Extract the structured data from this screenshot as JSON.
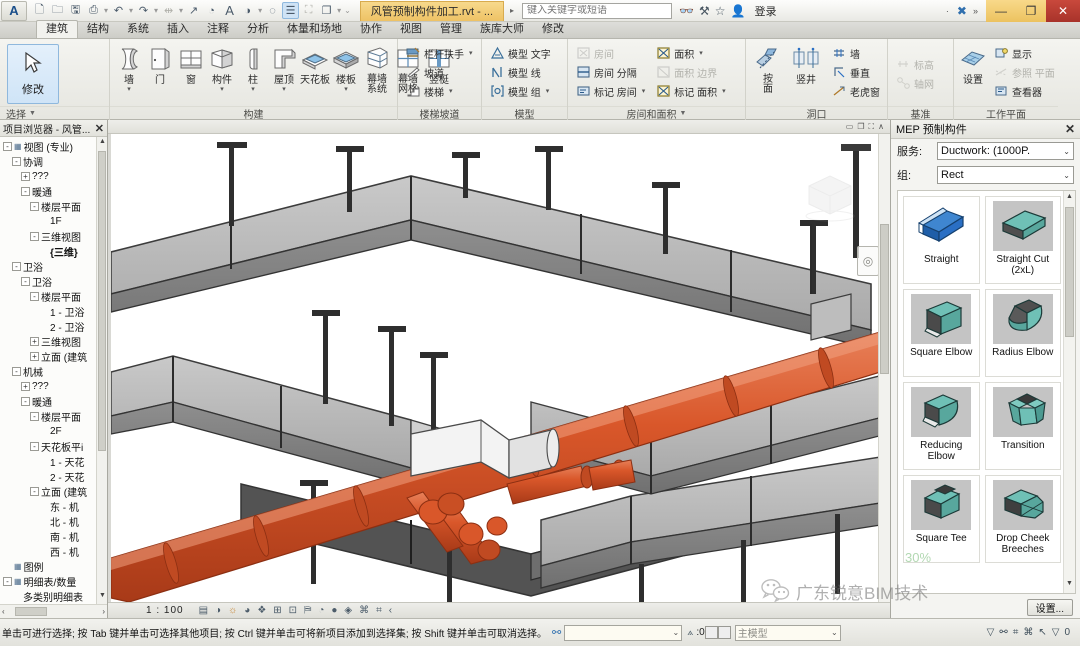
{
  "titlebar": {
    "app_button": "A",
    "doc_title": "风管预制构件加工.rvt - ...",
    "search_placeholder": "键入关键字或短语",
    "signin_label": "登录",
    "quick_access": [
      {
        "name": "new-file-icon",
        "glyph": "⬜"
      },
      {
        "name": "open-file-icon",
        "glyph": "🗁"
      },
      {
        "name": "save-icon",
        "glyph": "💾"
      },
      {
        "name": "print-icon",
        "glyph": "⎙"
      },
      {
        "name": "undo-icon",
        "glyph": "↶"
      },
      {
        "name": "redo-icon",
        "glyph": "↷"
      },
      {
        "name": "measure-icon",
        "glyph": "⇔"
      },
      {
        "name": "aligned-dimension-icon",
        "glyph": "↗"
      },
      {
        "name": "tag-icon",
        "glyph": "◔"
      },
      {
        "name": "text-icon",
        "glyph": "A"
      },
      {
        "name": "default-3d-view-icon",
        "glyph": "◑"
      },
      {
        "name": "section-icon",
        "glyph": "○"
      },
      {
        "name": "thin-lines-icon",
        "glyph": "☷"
      },
      {
        "name": "close-hidden-windows-icon",
        "glyph": "⛶"
      },
      {
        "name": "switch-windows-icon",
        "glyph": "❐"
      }
    ],
    "toolbar_icons": [
      {
        "name": "help-search-icon",
        "glyph": "♀"
      },
      {
        "name": "exchange-icon",
        "glyph": "⚒"
      },
      {
        "name": "favorites-star-icon",
        "glyph": "☆"
      },
      {
        "name": "user-account-icon",
        "glyph": "👤"
      }
    ],
    "window_controls": [
      {
        "name": "minimize-button",
        "glyph": "—"
      },
      {
        "name": "maximize-button",
        "glyph": "❐"
      },
      {
        "name": "close-button",
        "glyph": "✕"
      }
    ]
  },
  "ribbon_tabs": [
    {
      "label": "建筑",
      "active": true
    },
    {
      "label": "结构",
      "active": false
    },
    {
      "label": "系统",
      "active": false
    },
    {
      "label": "插入",
      "active": false
    },
    {
      "label": "注释",
      "active": false
    },
    {
      "label": "分析",
      "active": false
    },
    {
      "label": "体量和场地",
      "active": false
    },
    {
      "label": "协作",
      "active": false
    },
    {
      "label": "视图",
      "active": false
    },
    {
      "label": "管理",
      "active": false
    },
    {
      "label": "族库大师",
      "active": false
    },
    {
      "label": "修改",
      "active": false
    }
  ],
  "ribbon": {
    "select_panel": {
      "title": "选择",
      "modify_label": "修改"
    },
    "build_panel": {
      "title": "构建",
      "items": [
        {
          "label": "墙",
          "dropdown": true,
          "icon": "wall-icon"
        },
        {
          "label": "门",
          "dropdown": false,
          "icon": "door-icon"
        },
        {
          "label": "窗",
          "dropdown": false,
          "icon": "window-icon"
        },
        {
          "label": "构件",
          "dropdown": true,
          "icon": "component-icon"
        },
        {
          "label": "柱",
          "dropdown": true,
          "icon": "column-icon"
        },
        {
          "label": "屋顶",
          "dropdown": true,
          "icon": "roof-icon"
        },
        {
          "label": "天花板",
          "dropdown": false,
          "icon": "ceiling-icon"
        },
        {
          "label": "楼板",
          "dropdown": true,
          "icon": "floor-icon"
        },
        {
          "label": "幕墙\n系统",
          "dropdown": false,
          "icon": "curtain-system-icon"
        },
        {
          "label": "幕墙\n网格",
          "dropdown": false,
          "icon": "curtain-grid-icon"
        },
        {
          "label": "竖梃",
          "dropdown": false,
          "icon": "mullion-icon"
        }
      ]
    },
    "stairs_panel": {
      "title": "楼梯坡道",
      "items": [
        {
          "label": "栏杆扶手",
          "dropdown": true,
          "icon": "railing-icon",
          "disabled": false
        },
        {
          "label": "坡道",
          "dropdown": false,
          "icon": "ramp-icon",
          "disabled": false
        },
        {
          "label": "楼梯",
          "dropdown": true,
          "icon": "stairs-icon",
          "disabled": false
        }
      ]
    },
    "model_panel": {
      "title": "模型",
      "items": [
        {
          "label": "模型 文字",
          "dropdown": false,
          "icon": "model-text-icon",
          "disabled": false
        },
        {
          "label": "模型 线",
          "dropdown": false,
          "icon": "model-line-icon",
          "disabled": false
        },
        {
          "label": "模型 组",
          "dropdown": true,
          "icon": "model-group-icon",
          "disabled": false
        }
      ]
    },
    "room_area_panel": {
      "title": "房间和面积",
      "dropdown": true,
      "col_a": [
        {
          "label": "房间",
          "dropdown": false,
          "icon": "room-icon",
          "disabled": true
        },
        {
          "label": "房间 分隔",
          "dropdown": false,
          "icon": "room-separator-icon",
          "disabled": false
        },
        {
          "label": "标记 房间",
          "dropdown": true,
          "icon": "tag-room-icon",
          "disabled": false
        }
      ],
      "col_b": [
        {
          "label": "面积",
          "dropdown": true,
          "icon": "area-icon",
          "disabled": false
        },
        {
          "label": "面积 边界",
          "dropdown": false,
          "icon": "area-boundary-icon",
          "disabled": true
        },
        {
          "label": "标记 面积",
          "dropdown": true,
          "icon": "tag-area-icon",
          "disabled": false
        }
      ]
    },
    "opening_panel": {
      "title": "洞口",
      "big_items": [
        {
          "label": "按\n面",
          "icon": "by-face-icon"
        },
        {
          "label": "竖井",
          "icon": "shaft-icon"
        }
      ],
      "small_items": [
        {
          "label": "墙",
          "icon": "wall-opening-icon"
        },
        {
          "label": "垂直",
          "icon": "vertical-opening-icon"
        },
        {
          "label": "老虎窗",
          "icon": "dormer-opening-icon"
        }
      ]
    },
    "datum_panel": {
      "title": "基准",
      "items": [
        {
          "label": "标高",
          "icon": "level-icon",
          "disabled": true
        },
        {
          "label": "轴网",
          "icon": "grid-icon",
          "disabled": true
        }
      ]
    },
    "workplane_panel": {
      "title": "工作平面",
      "set_label": "设置",
      "items": [
        {
          "label": "显示",
          "icon": "show-workplane-icon",
          "disabled": false
        },
        {
          "label": "参照 平面",
          "icon": "reference-plane-icon",
          "disabled": true
        },
        {
          "label": "查看器",
          "icon": "viewer-icon",
          "disabled": false
        }
      ]
    }
  },
  "browser": {
    "title": "项目浏览器 - 风管...",
    "close_glyph": "✕",
    "tree": [
      {
        "label": "视图 (专业)",
        "indent": 0,
        "expander": "-",
        "icon": "view-folder-icon",
        "bold": false
      },
      {
        "label": "协调",
        "indent": 1,
        "expander": "-",
        "icon": "",
        "bold": false
      },
      {
        "label": "???",
        "indent": 2,
        "expander": "+",
        "icon": "",
        "bold": false
      },
      {
        "label": "暖通",
        "indent": 2,
        "expander": "-",
        "icon": "",
        "bold": false
      },
      {
        "label": "楼层平面",
        "indent": 3,
        "expander": "-",
        "icon": "",
        "bold": false
      },
      {
        "label": "1F",
        "indent": 4,
        "expander": "",
        "icon": "",
        "bold": false
      },
      {
        "label": "三维视图",
        "indent": 3,
        "expander": "-",
        "icon": "",
        "bold": false
      },
      {
        "label": "{三维}",
        "indent": 4,
        "expander": "",
        "icon": "",
        "bold": true
      },
      {
        "label": "卫浴",
        "indent": 1,
        "expander": "-",
        "icon": "",
        "bold": false
      },
      {
        "label": "卫浴",
        "indent": 2,
        "expander": "-",
        "icon": "",
        "bold": false
      },
      {
        "label": "楼层平面",
        "indent": 3,
        "expander": "-",
        "icon": "",
        "bold": false
      },
      {
        "label": "1 - 卫浴",
        "indent": 4,
        "expander": "",
        "icon": "",
        "bold": false
      },
      {
        "label": "2 - 卫浴",
        "indent": 4,
        "expander": "",
        "icon": "",
        "bold": false
      },
      {
        "label": "三维视图",
        "indent": 3,
        "expander": "+",
        "icon": "",
        "bold": false
      },
      {
        "label": "立面 (建筑",
        "indent": 3,
        "expander": "+",
        "icon": "",
        "bold": false
      },
      {
        "label": "机械",
        "indent": 1,
        "expander": "-",
        "icon": "",
        "bold": false
      },
      {
        "label": "???",
        "indent": 2,
        "expander": "+",
        "icon": "",
        "bold": false
      },
      {
        "label": "暖通",
        "indent": 2,
        "expander": "-",
        "icon": "",
        "bold": false
      },
      {
        "label": "楼层平面",
        "indent": 3,
        "expander": "-",
        "icon": "",
        "bold": false
      },
      {
        "label": "2F",
        "indent": 4,
        "expander": "",
        "icon": "",
        "bold": false
      },
      {
        "label": "天花板平i",
        "indent": 3,
        "expander": "-",
        "icon": "",
        "bold": false
      },
      {
        "label": "1 - 天花",
        "indent": 4,
        "expander": "",
        "icon": "",
        "bold": false
      },
      {
        "label": "2 - 天花",
        "indent": 4,
        "expander": "",
        "icon": "",
        "bold": false
      },
      {
        "label": "立面 (建筑",
        "indent": 3,
        "expander": "-",
        "icon": "",
        "bold": false
      },
      {
        "label": "东 - 机",
        "indent": 4,
        "expander": "",
        "icon": "",
        "bold": false
      },
      {
        "label": "北 - 机",
        "indent": 4,
        "expander": "",
        "icon": "",
        "bold": false
      },
      {
        "label": "南 - 机",
        "indent": 4,
        "expander": "",
        "icon": "",
        "bold": false
      },
      {
        "label": "西 - 机",
        "indent": 4,
        "expander": "",
        "icon": "",
        "bold": false
      },
      {
        "label": "图例",
        "indent": 0,
        "expander": "",
        "icon": "legend-icon",
        "bold": false
      },
      {
        "label": "明细表/数量",
        "indent": 0,
        "expander": "-",
        "icon": "schedule-icon",
        "bold": false
      },
      {
        "label": "多类别明细表",
        "indent": 1,
        "expander": "",
        "icon": "",
        "bold": false
      }
    ]
  },
  "viewport": {
    "scale": "1 : 100",
    "top_controls": [
      {
        "name": "minimize-view-icon",
        "glyph": "—"
      },
      {
        "name": "restore-view-icon",
        "glyph": "❐"
      },
      {
        "name": "maximize-view-icon",
        "glyph": "⛶"
      },
      {
        "name": "collapse-ribbon-icon",
        "glyph": "∧"
      }
    ],
    "view_controls": [
      {
        "name": "detail-level-icon",
        "glyph": "☷",
        "accent": false
      },
      {
        "name": "visual-style-icon",
        "glyph": "◑",
        "accent": false
      },
      {
        "name": "sun-path-icon",
        "glyph": "☼",
        "accent": true
      },
      {
        "name": "shadows-icon",
        "glyph": "◕",
        "accent": false
      },
      {
        "name": "render-dialog-icon",
        "glyph": "❦",
        "accent": false
      },
      {
        "name": "crop-view-icon",
        "glyph": "⊞",
        "accent": false
      },
      {
        "name": "show-crop-region-icon",
        "glyph": "⊡",
        "accent": false
      },
      {
        "name": "lock-3d-view-icon",
        "glyph": "⚿",
        "accent": false
      },
      {
        "name": "temporary-hide-isolate-icon",
        "glyph": "◔",
        "accent": false
      },
      {
        "name": "reveal-hidden-elements-icon",
        "glyph": "●",
        "accent": false
      },
      {
        "name": "temporary-view-properties-icon",
        "glyph": "◈",
        "accent": false
      },
      {
        "name": "analytical-model-icon",
        "glyph": "⌘",
        "accent": false
      },
      {
        "name": "constraints-icon",
        "glyph": "⌗",
        "accent": false
      },
      {
        "name": "more-view-controls-icon",
        "glyph": "‹",
        "accent": false
      }
    ],
    "navwheel_icon": "navigation-wheel-icon",
    "viewcube_icon": "view-cube-icon"
  },
  "mep_panel": {
    "title": "MEP 预制构件",
    "close_glyph": "✕",
    "service_label": "服务:",
    "service_value": "Ductwork: (1000P.",
    "group_label": "组:",
    "group_value": "Rect",
    "settings_button": "设置...",
    "parts": [
      {
        "caption": "Straight",
        "icon": "duct-straight-icon",
        "accent": "#2a6fc4",
        "white_bg": true
      },
      {
        "caption": "Straight Cut\n(2xL)",
        "icon": "duct-straight-cut-icon",
        "accent": "#5fb3ab",
        "white_bg": false
      },
      {
        "caption": "Square Elbow",
        "icon": "duct-square-elbow-icon",
        "accent": "#5fb3ab",
        "white_bg": false
      },
      {
        "caption": "Radius Elbow",
        "icon": "duct-radius-elbow-icon",
        "accent": "#5fb3ab",
        "white_bg": false
      },
      {
        "caption": "Reducing\nElbow",
        "icon": "duct-reducing-elbow-icon",
        "accent": "#5fb3ab",
        "white_bg": false
      },
      {
        "caption": "Transition",
        "icon": "duct-transition-icon",
        "accent": "#5fb3ab",
        "white_bg": false
      },
      {
        "caption": "Square Tee",
        "icon": "duct-square-tee-icon",
        "accent": "#5fb3ab",
        "white_bg": false
      },
      {
        "caption": "Drop Cheek\nBreeches",
        "icon": "duct-drop-cheek-breeches-icon",
        "accent": "#5fb3ab",
        "white_bg": false
      }
    ]
  },
  "statusbar": {
    "hint": "单击可进行选择; 按 Tab 键并单击可选择其他项目; 按 Ctrl 键并单击可将新项目添加到选择集; 按 Shift 键并单击可取消选择。",
    "chain_icon": "worksets-icon",
    "field_value": "",
    "count": ":0",
    "model_select_value": "主模型",
    "right_icons": [
      {
        "name": "exclude-options-icon",
        "glyph": "▽"
      },
      {
        "name": "select-links-icon",
        "glyph": "⚯"
      },
      {
        "name": "select-underlay-icon",
        "glyph": "⌗"
      },
      {
        "name": "select-pinned-icon",
        "glyph": "⌘"
      },
      {
        "name": "select-by-face-icon",
        "glyph": "↖"
      },
      {
        "name": "filter-icon",
        "glyph": "▽"
      }
    ],
    "filter_count": "0"
  },
  "watermark": {
    "logo_icon": "wechat-logo-icon",
    "text": "广东锐意BIM技术",
    "badge": "30%"
  },
  "colors": {
    "accent_orange": "#d8532a",
    "title_gold": "#eec265",
    "close_red": "#b8382c",
    "duct_teal": "#5fb3ab",
    "duct_blue": "#2a6fc4",
    "selection_blue": "#cfe4f7"
  }
}
